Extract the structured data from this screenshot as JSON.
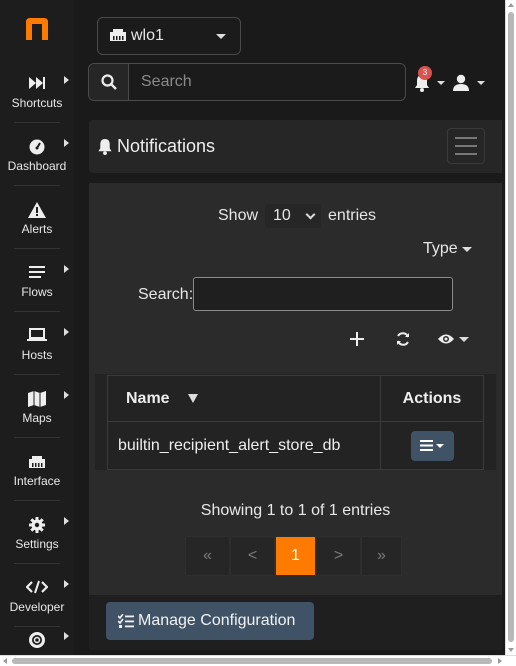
{
  "colors": {
    "brand": "#ff7a00",
    "accent_button": "#3f5266",
    "badge": "#d9534f"
  },
  "sidebar": {
    "items": [
      {
        "label": "Shortcuts",
        "icon": "fast-forward-icon",
        "has_submenu": true
      },
      {
        "label": "Dashboard",
        "icon": "gauge-icon",
        "has_submenu": true
      },
      {
        "label": "Alerts",
        "icon": "warning-icon",
        "has_submenu": false
      },
      {
        "label": "Flows",
        "icon": "stream-icon",
        "has_submenu": true
      },
      {
        "label": "Hosts",
        "icon": "laptop-icon",
        "has_submenu": true
      },
      {
        "label": "Maps",
        "icon": "map-icon",
        "has_submenu": true
      },
      {
        "label": "Interface",
        "icon": "ethernet-icon",
        "has_submenu": false
      },
      {
        "label": "Settings",
        "icon": "gear-icon",
        "has_submenu": true
      },
      {
        "label": "Developer",
        "icon": "code-icon",
        "has_submenu": true
      },
      {
        "label": "",
        "icon": "lifebuoy-icon",
        "has_submenu": true
      }
    ]
  },
  "topbar": {
    "interface": "wlo1",
    "search_placeholder": "Search",
    "notification_count": "3"
  },
  "page": {
    "title": "Notifications"
  },
  "table_controls": {
    "show_label": "Show",
    "entries_value": "10",
    "entries_label": "entries",
    "type_filter": "Type",
    "search_label": "Search:",
    "search_value": ""
  },
  "table": {
    "columns": [
      "Name",
      "Actions"
    ],
    "rows": [
      {
        "name": "builtin_recipient_alert_store_db"
      }
    ]
  },
  "info": "Showing 1 to 1 of 1 entries",
  "pagination": {
    "first": "«",
    "prev": "<",
    "current": "1",
    "next": ">",
    "last": "»"
  },
  "manage_button": "Manage Configuration"
}
